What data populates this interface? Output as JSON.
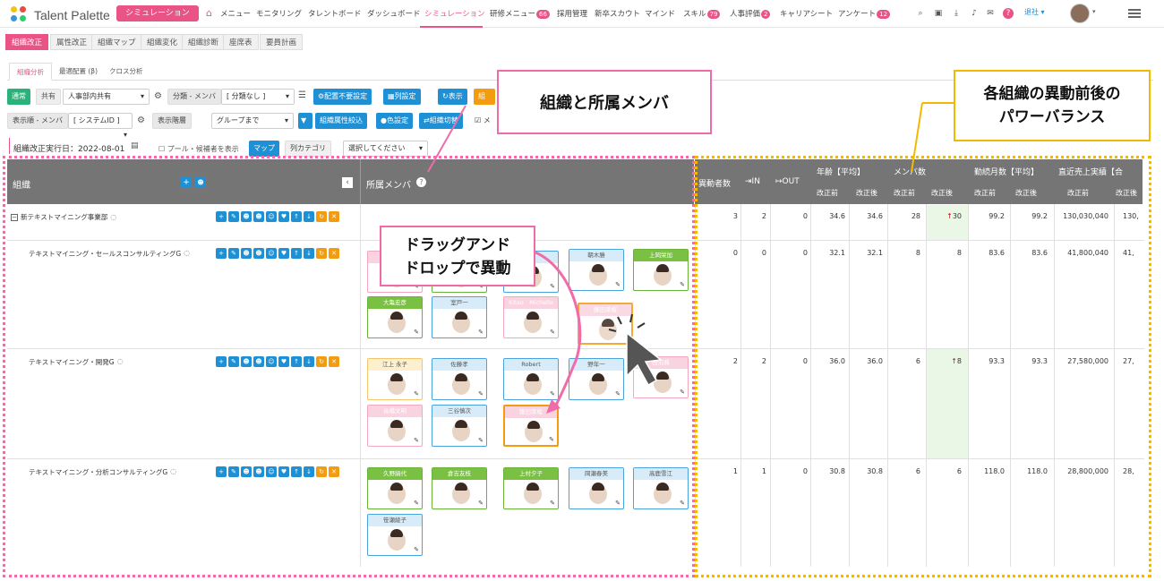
{
  "app": {
    "logo_text": "Talent Palette",
    "simulation_button": "シミュレーション",
    "nav": [
      {
        "label": "メニュー"
      },
      {
        "label": "モニタリング"
      },
      {
        "label": "タレントボード"
      },
      {
        "label": "ダッシュボード"
      },
      {
        "label": "シミュレーション"
      },
      {
        "label": "研修メニュー",
        "badge": "66"
      },
      {
        "label": "採用管理"
      },
      {
        "label": "新卒スカウト"
      },
      {
        "label": "マインド"
      },
      {
        "label": "スキル",
        "badge": "79"
      },
      {
        "label": "人事評価",
        "badge": "2"
      },
      {
        "label": "キャリアシート"
      },
      {
        "label": "アンケート",
        "badge": "12"
      }
    ],
    "user_label": "退社"
  },
  "subtabs": [
    "組織改正",
    "属性改正",
    "組織マップ",
    "組織変化",
    "組織診断",
    "座席表",
    "要員計画"
  ],
  "inner_tabs": [
    "組織分析",
    "最適配置 (β)",
    "クロス分析"
  ],
  "toolbar": {
    "normal": "通常",
    "shared": "共有",
    "share_select": "人事部内共有",
    "class_label": "分類 - メンバ",
    "class_select": "[ 分類なし ]",
    "unneeded_btn": "配置不要設定",
    "column_btn": "列設定",
    "show_btn": "表示",
    "org_btn": "組",
    "order_label": "表示順 - メンバ",
    "order_select": "[ システムID ]",
    "hierarchy_label": "表示階層",
    "hierarchy_select": "グループまで",
    "attr_filter_btn": "組織属性絞込",
    "color_btn": "色設定",
    "switch_btn": "組織切替",
    "check_label": "メ",
    "exec_date": "組織改正実行日：2022-08-01",
    "pool_label": "プール・候補者を表示",
    "map_btn": "マップ",
    "category_label": "列カテゴリ",
    "category_select": "選択してください"
  },
  "table": {
    "org_header": "組織",
    "members_header": "所属メンバ",
    "cols": {
      "movers": "異動者数",
      "in": "IN",
      "out": "OUT",
      "age": "年齢【平均】",
      "members": "メンバ数",
      "tenure": "勤続月数【平均】",
      "sales": "直近売上実績【合",
      "before": "改正前",
      "after": "改正後"
    },
    "rows": [
      {
        "org": "新テキストマイニング事業部",
        "movers": "3",
        "in": "2",
        "out": "0",
        "age_b": "34.6",
        "age_a": "34.6",
        "mem_b": "28",
        "mem_a": "30",
        "ten_b": "99.2",
        "ten_a": "99.2",
        "sales_b": "130,030,040",
        "sales_a": "130,"
      },
      {
        "org": "テキストマイニング・セールスコンサルティングG",
        "movers": "0",
        "in": "0",
        "out": "0",
        "age_b": "32.1",
        "age_a": "32.1",
        "mem_b": "8",
        "mem_a": "8",
        "ten_b": "83.6",
        "ten_a": "83.6",
        "sales_b": "41,800,040",
        "sales_a": "41,"
      },
      {
        "org": "テキストマイニング・開発G",
        "movers": "2",
        "in": "2",
        "out": "0",
        "age_b": "36.0",
        "age_a": "36.0",
        "mem_b": "6",
        "mem_a": "8",
        "ten_b": "93.3",
        "ten_a": "93.3",
        "sales_b": "27,580,000",
        "sales_a": "27,"
      },
      {
        "org": "テキストマイニング・分析コンサルティングG",
        "movers": "1",
        "in": "1",
        "out": "0",
        "age_b": "30.8",
        "age_a": "30.8",
        "mem_b": "6",
        "mem_a": "6",
        "ten_b": "118.0",
        "ten_a": "118.0",
        "sales_b": "28,800,000",
        "sales_a": "28,"
      }
    ],
    "cards": {
      "r1": [
        "",
        "",
        "",
        "朝木勝",
        "上岡栄加",
        "大亀宏彦",
        "室戸一",
        "Kitao　Michelle",
        "鎌田菜桜"
      ],
      "r2": [
        "江上 永子",
        "佐藤孝",
        "Robert",
        "野年一",
        "田沼典",
        "長橋文明",
        "三谷慎次",
        "鎌田菜桜"
      ],
      "r3": [
        "久野絹代",
        "倉吉友枝",
        "上村夕子",
        "岡瀬春美",
        "高鹿雪江",
        "笹瀬綾子"
      ]
    }
  },
  "callouts": {
    "org": "組織と所属メンバ",
    "power_line1": "各組織の異動前後の",
    "power_line2": "パワーバランス",
    "drag_line1": "ドラッグアンド",
    "drag_line2": "ドロップで異動"
  },
  "colors": {
    "brand_pink": "#e95386",
    "blue": "#1e90d6",
    "green": "#2ab27b",
    "orange": "#f39c12",
    "header_gray": "#757575",
    "callout_yellow": "#f5b800"
  }
}
